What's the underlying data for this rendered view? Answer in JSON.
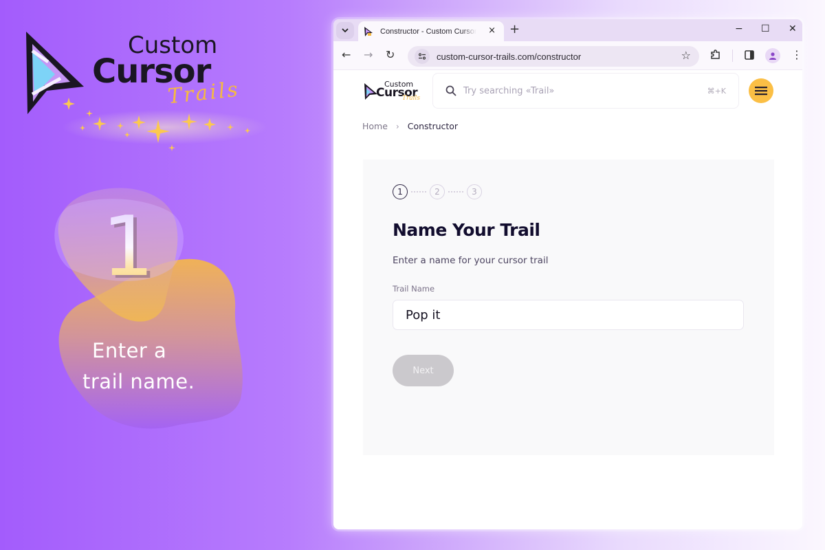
{
  "promo": {
    "logo": {
      "line1": "Custom",
      "line2": "Cursor",
      "line3": "Trails"
    },
    "step_number": "1",
    "caption_line1": "Enter a",
    "caption_line2": "trail name."
  },
  "browser": {
    "tab": {
      "title": "Constructor - Custom Cursor Trails",
      "close_icon": "×",
      "favicon": "cursor-logo"
    },
    "new_tab_icon": "+",
    "window_controls": {
      "minimize": "−",
      "maximize": "☐",
      "close": "✕"
    },
    "toolbar": {
      "back_icon": "←",
      "forward_icon": "→",
      "reload_icon": "↻",
      "url": "custom-cursor-trails.com/constructor",
      "bookmark_icon": "☆",
      "menu_icon": "⋮"
    }
  },
  "site": {
    "logo": {
      "line1": "Custom",
      "line2": "Cursor",
      "line3": "Trails"
    },
    "search": {
      "placeholder": "Try searching «Trail»",
      "shortcut": "⌘+K"
    },
    "breadcrumb": {
      "home": "Home",
      "separator": "›",
      "current": "Constructor"
    },
    "constructor": {
      "steps": [
        "1",
        "2",
        "3"
      ],
      "active_step": 1,
      "title": "Name Your Trail",
      "subtitle": "Enter a name for your cursor trail",
      "field_label": "Trail Name",
      "field_value": "Pop it",
      "next_label": "Next",
      "next_enabled": false
    }
  },
  "colors": {
    "accent_yellow": "#fbbf45",
    "background_purple": "#a35cfc",
    "title_navy": "#120d2e",
    "button_disabled": "#cbc9cd"
  }
}
